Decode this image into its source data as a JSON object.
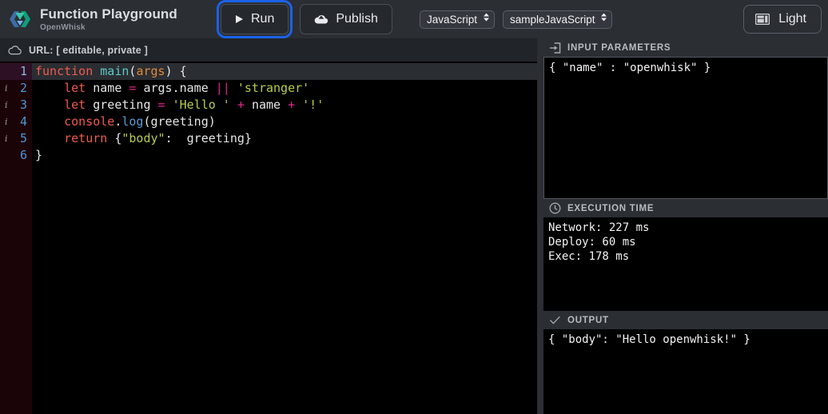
{
  "header": {
    "brand": {
      "title": "Function Playground",
      "subtitle": "OpenWhisk",
      "logo_icon": "openwhisk-logo"
    },
    "run_button": {
      "label": "Run",
      "icon": "play-icon",
      "focused": true
    },
    "publish_button": {
      "label": "Publish",
      "icon": "cloud-upload-icon"
    },
    "language_select": {
      "value": "JavaScript",
      "options": [
        "JavaScript"
      ],
      "icon": "chevron-updown-icon"
    },
    "sample_select": {
      "value": "sampleJavaScript",
      "options": [
        "sampleJavaScript"
      ],
      "icon": "chevron-updown-icon"
    },
    "theme_button": {
      "label": "Light",
      "icon": "layout-panel-icon"
    }
  },
  "urlbar": {
    "icon": "cloud-icon",
    "label": "URL: [ editable, private ]"
  },
  "editor": {
    "active_line": 1,
    "fold_marker": "▾",
    "info_marker": "i",
    "lines": [
      {
        "num": "1",
        "info": false,
        "fold": true,
        "text": "function main(args) {"
      },
      {
        "num": "2",
        "info": true,
        "fold": false,
        "text": "    let name = args.name || 'stranger'"
      },
      {
        "num": "3",
        "info": true,
        "fold": false,
        "text": "    let greeting = 'Hello ' + name + '!'"
      },
      {
        "num": "4",
        "info": true,
        "fold": false,
        "text": "    console.log(greeting)"
      },
      {
        "num": "5",
        "info": true,
        "fold": false,
        "text": "    return {\"body\":  greeting}"
      },
      {
        "num": "6",
        "info": false,
        "fold": false,
        "text": "}"
      }
    ]
  },
  "panels": {
    "input": {
      "title": "INPUT PARAMETERS",
      "icon": "arrow-into-box-icon",
      "content": "{ \"name\" : \"openwhisk\" }"
    },
    "execution_time": {
      "title": "EXECUTION TIME",
      "icon": "clock-icon",
      "content": "Network: 227 ms\nDeploy: 60 ms\nExec: 178 ms",
      "network_ms": "227",
      "deploy_ms": "60",
      "exec_ms": "178"
    },
    "output": {
      "title": "OUTPUT",
      "icon": "check-icon",
      "content": "{ \"body\": \"Hello openwhisk!\" }"
    }
  },
  "colors": {
    "focus_ring": "#1b62e8",
    "chrome_bg": "#2b2e33",
    "editor_bg": "#000000",
    "gutter_bg": "#1b0407",
    "linenum": "#4e96d6",
    "keyword": "#f05a4f",
    "string": "#b8cc4a",
    "operator": "#e0268c",
    "function": "#5ec8c8",
    "param": "#e08a3c"
  }
}
